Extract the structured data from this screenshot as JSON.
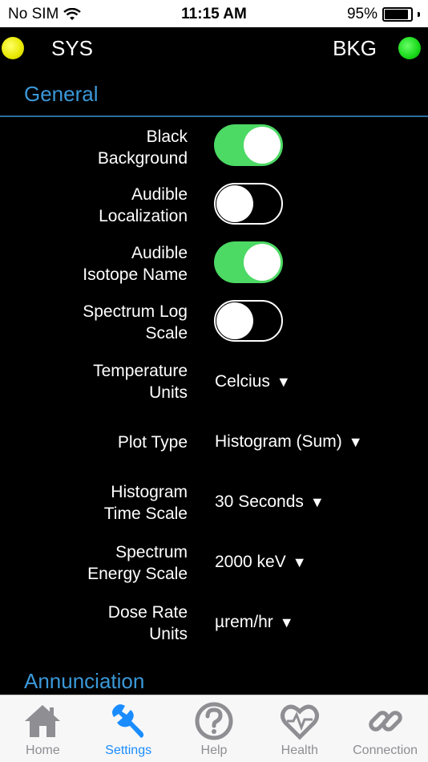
{
  "status_bar": {
    "carrier": "No SIM",
    "time": "11:15 AM",
    "battery": "95%",
    "battery_level": 0.95
  },
  "indicators": {
    "left_label": "SYS",
    "right_label": "BKG",
    "left_color": "#ffff00",
    "right_color": "#00ff00"
  },
  "sections": {
    "general": "General",
    "annunciation": "Annunciation"
  },
  "settings": {
    "black_background": {
      "line1": "Black",
      "line2": "Background",
      "on": true
    },
    "audible_localization": {
      "line1": "Audible",
      "line2": "Localization",
      "on": false
    },
    "audible_isotope": {
      "line1": "Audible",
      "line2": "Isotope Name",
      "on": true
    },
    "spectrum_log": {
      "line1": "Spectrum Log",
      "line2": "Scale",
      "on": false
    },
    "temperature_units": {
      "line1": "Temperature",
      "line2": "Units",
      "value": "Celcius"
    },
    "plot_type": {
      "line1": "Plot Type",
      "value": "Histogram (Sum)"
    },
    "histogram_time": {
      "line1": "Histogram",
      "line2": "Time Scale",
      "value": "30 Seconds"
    },
    "spectrum_energy": {
      "line1": "Spectrum",
      "line2": "Energy Scale",
      "value": "2000 keV"
    },
    "dose_rate": {
      "line1": "Dose Rate",
      "line2": "Units",
      "value": "µrem/hr"
    }
  },
  "tabs": [
    {
      "label": "Home",
      "icon": "home-icon"
    },
    {
      "label": "Settings",
      "icon": "wrench-icon",
      "active": true
    },
    {
      "label": "Help",
      "icon": "help-icon"
    },
    {
      "label": "Health",
      "icon": "heart-icon"
    },
    {
      "label": "Connection",
      "icon": "link-icon"
    }
  ],
  "colors": {
    "accent": "#3b98d8",
    "toggle_on": "#4cd964",
    "tab_active": "#1a8cff",
    "tab_inactive": "#8e8e93"
  }
}
